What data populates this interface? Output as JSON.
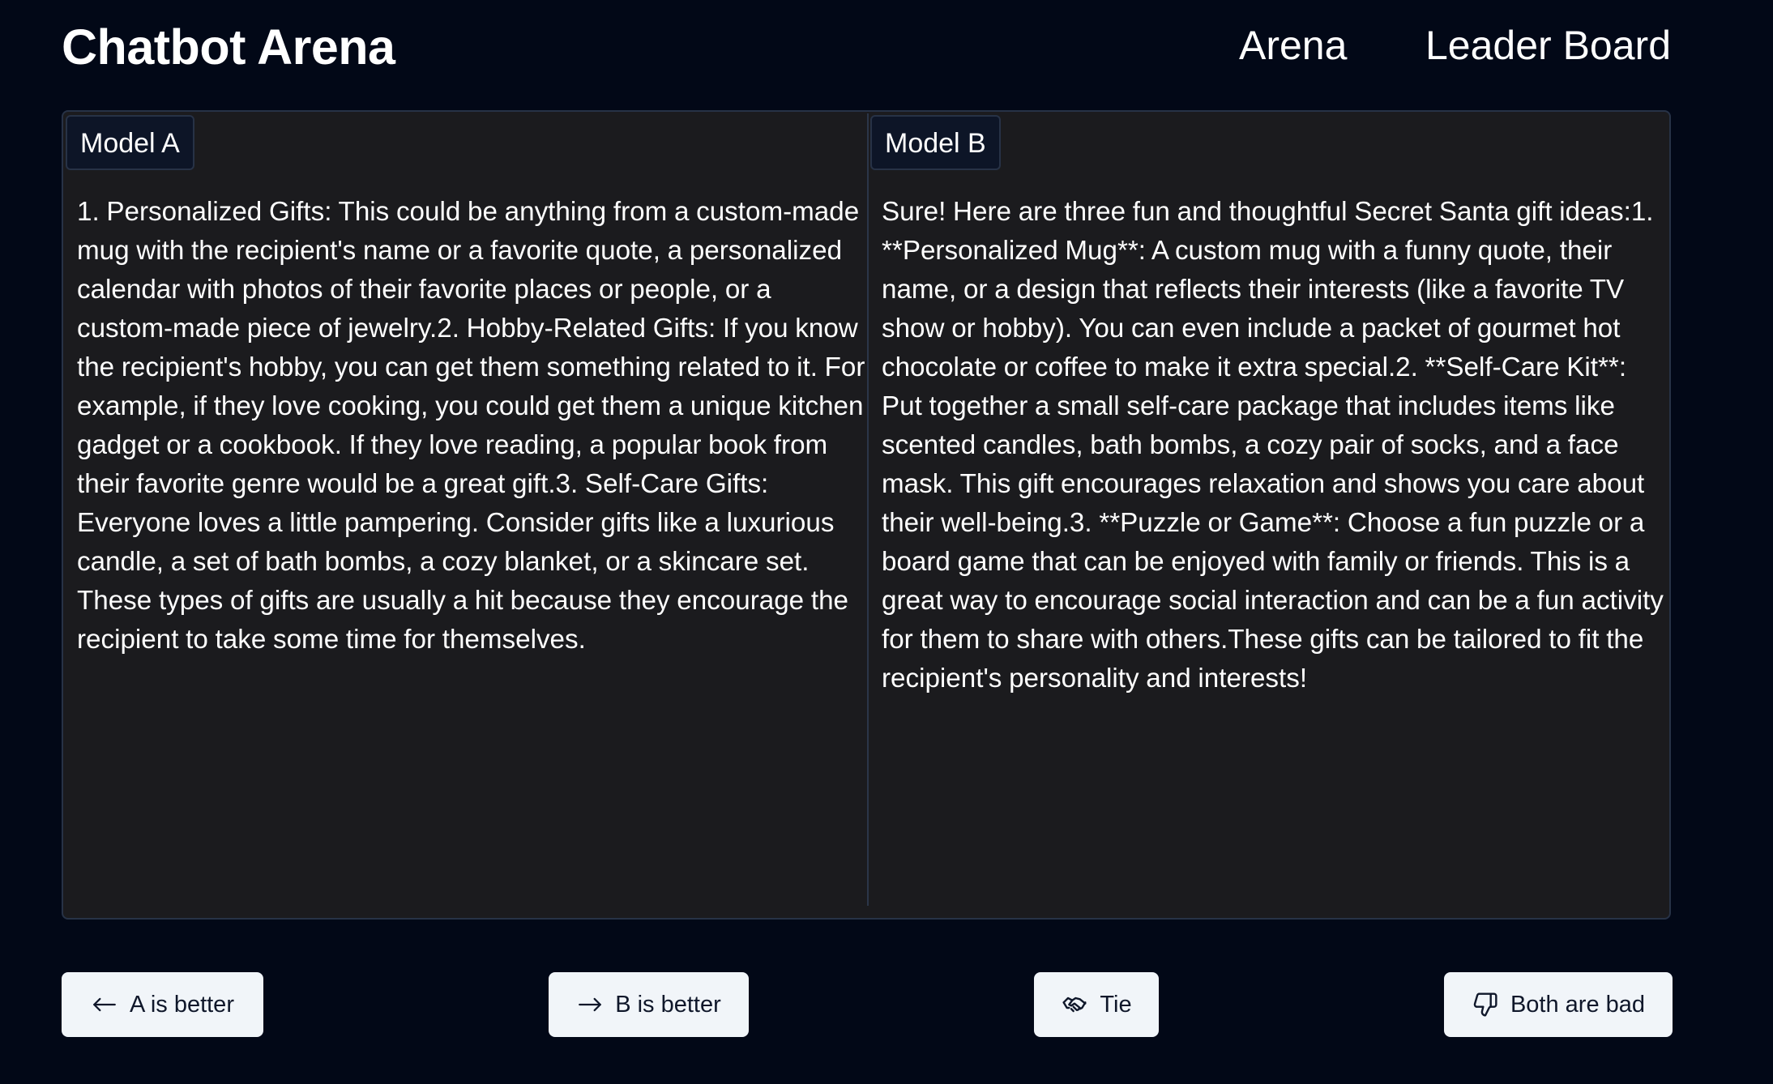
{
  "header": {
    "title": "Chatbot Arena",
    "nav": [
      {
        "label": "Arena"
      },
      {
        "label": "Leader Board"
      }
    ]
  },
  "models": [
    {
      "label": "Model A",
      "response": "1. Personalized Gifts: This could be anything from a custom-made mug with the recipient's name or a favorite quote, a personalized calendar with photos of their favorite places or people, or a custom-made piece of jewelry.2. Hobby-Related Gifts: If you know the recipient's hobby, you can get them something related to it. For example, if they love cooking, you could get them a unique kitchen gadget or a cookbook. If they love reading, a popular book from their favorite genre would be a great gift.3. Self-Care Gifts: Everyone loves a little pampering. Consider gifts like a luxurious candle, a set of bath bombs, a cozy blanket, or a skincare set. These types of gifts are usually a hit because they encourage the recipient to take some time for themselves."
    },
    {
      "label": "Model B",
      "response": "Sure! Here are three fun and thoughtful Secret Santa gift ideas:1. **Personalized Mug**: A custom mug with a funny quote, their name, or a design that reflects their interests (like a favorite TV show or hobby). You can even include a packet of gourmet hot chocolate or coffee to make it extra special.2. **Self-Care Kit**: Put together a small self-care package that includes items like scented candles, bath bombs, a cozy pair of socks, and a face mask. This gift encourages relaxation and shows you care about their well-being.3. **Puzzle or Game**: Choose a fun puzzle or a board game that can be enjoyed with family or friends. This is a great way to encourage social interaction and can be a fun activity for them to share with others.These gifts can be tailored to fit the recipient's personality and interests!"
    }
  ],
  "vote_buttons": [
    {
      "label": "A is better",
      "icon": "arrow-left-icon"
    },
    {
      "label": "B is better",
      "icon": "arrow-right-icon"
    },
    {
      "label": "Tie",
      "icon": "handshake-icon"
    },
    {
      "label": "Both are bad",
      "icon": "thumbs-down-icon"
    }
  ],
  "colors": {
    "background": "#020817",
    "panel": "#1b1b1e",
    "border": "#273246",
    "button": "#f1f5f9",
    "button_text": "#0f172a"
  }
}
